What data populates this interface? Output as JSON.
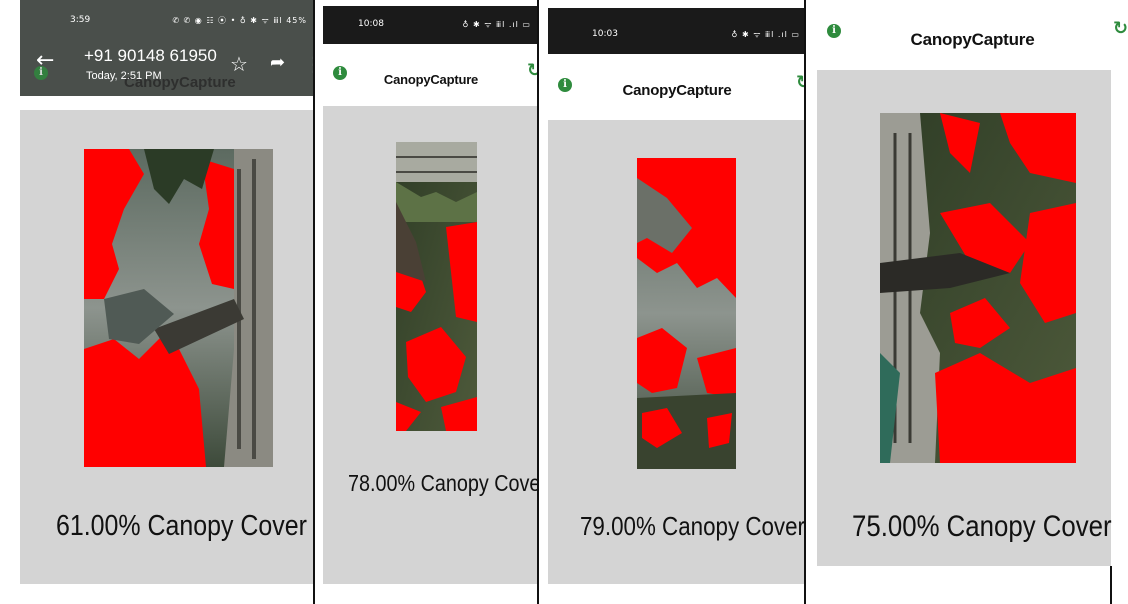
{
  "panels": [
    {
      "status_time": "3:59",
      "status_icons": "✆ ✆ ◉ ☷ ⦿ • ♁ ✱ ᯤ ⅲl 45%",
      "whatsapp": {
        "contact": "+91 90148 61950",
        "timestamp": "Today, 2:51 PM",
        "overlapped_title": "CanopyCapture"
      },
      "cover_text": "61.00% Canopy Cover"
    },
    {
      "status_time": "10:08",
      "status_icons": "♁ ✱ ᯤ ⅲl .ıl ▭",
      "title": "CanopyCapture",
      "cover_text": "78.00% Canopy Cover"
    },
    {
      "status_time": "10:03",
      "status_icons": "♁ ✱ ᯤ ⅲl .ıl ▭",
      "title": "CanopyCapture",
      "cover_text": "79.00% Canopy Cover"
    },
    {
      "title": "CanopyCapture",
      "cover_text": "75.00% Canopy Cover"
    }
  ],
  "icons": {
    "info": "i",
    "refresh": "↻",
    "back": "←",
    "star": "☆",
    "share": "➦",
    "more": "⋮"
  },
  "colors": {
    "canopy_mask": "#ff0000",
    "app_background": "#d4d4d4",
    "accent_green": "#2e8b3d"
  }
}
